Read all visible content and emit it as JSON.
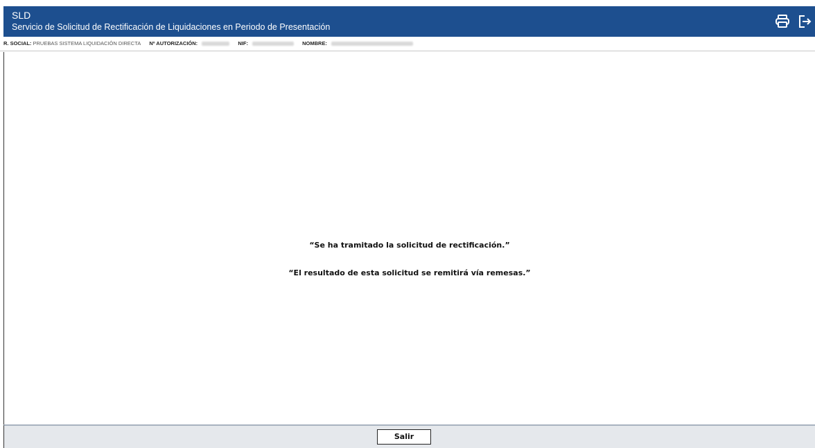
{
  "header": {
    "app_code": "SLD",
    "app_title": "Servicio de Solicitud de Rectificación de Liquidaciones en Periodo de Presentación",
    "icons": [
      "printer-icon",
      "logout-icon"
    ],
    "background_color": "#1d4f8f"
  },
  "info_bar": {
    "social_label": "R. SOCIAL:",
    "social_value": "PRUEBAS SISTEMA LIQUIDACIÓN DIRECTA",
    "autorizacion_label": "Nº AUTORIZACIÓN:",
    "nif_label": "NIF:",
    "nombre_label": "NOMBRE:"
  },
  "main": {
    "message_1": "“Se ha tramitado la solicitud de rectificación.”",
    "message_2": "“El resultado de esta solicitud se remitirá vía remesas.”"
  },
  "footer": {
    "salir_label": "Salir"
  }
}
